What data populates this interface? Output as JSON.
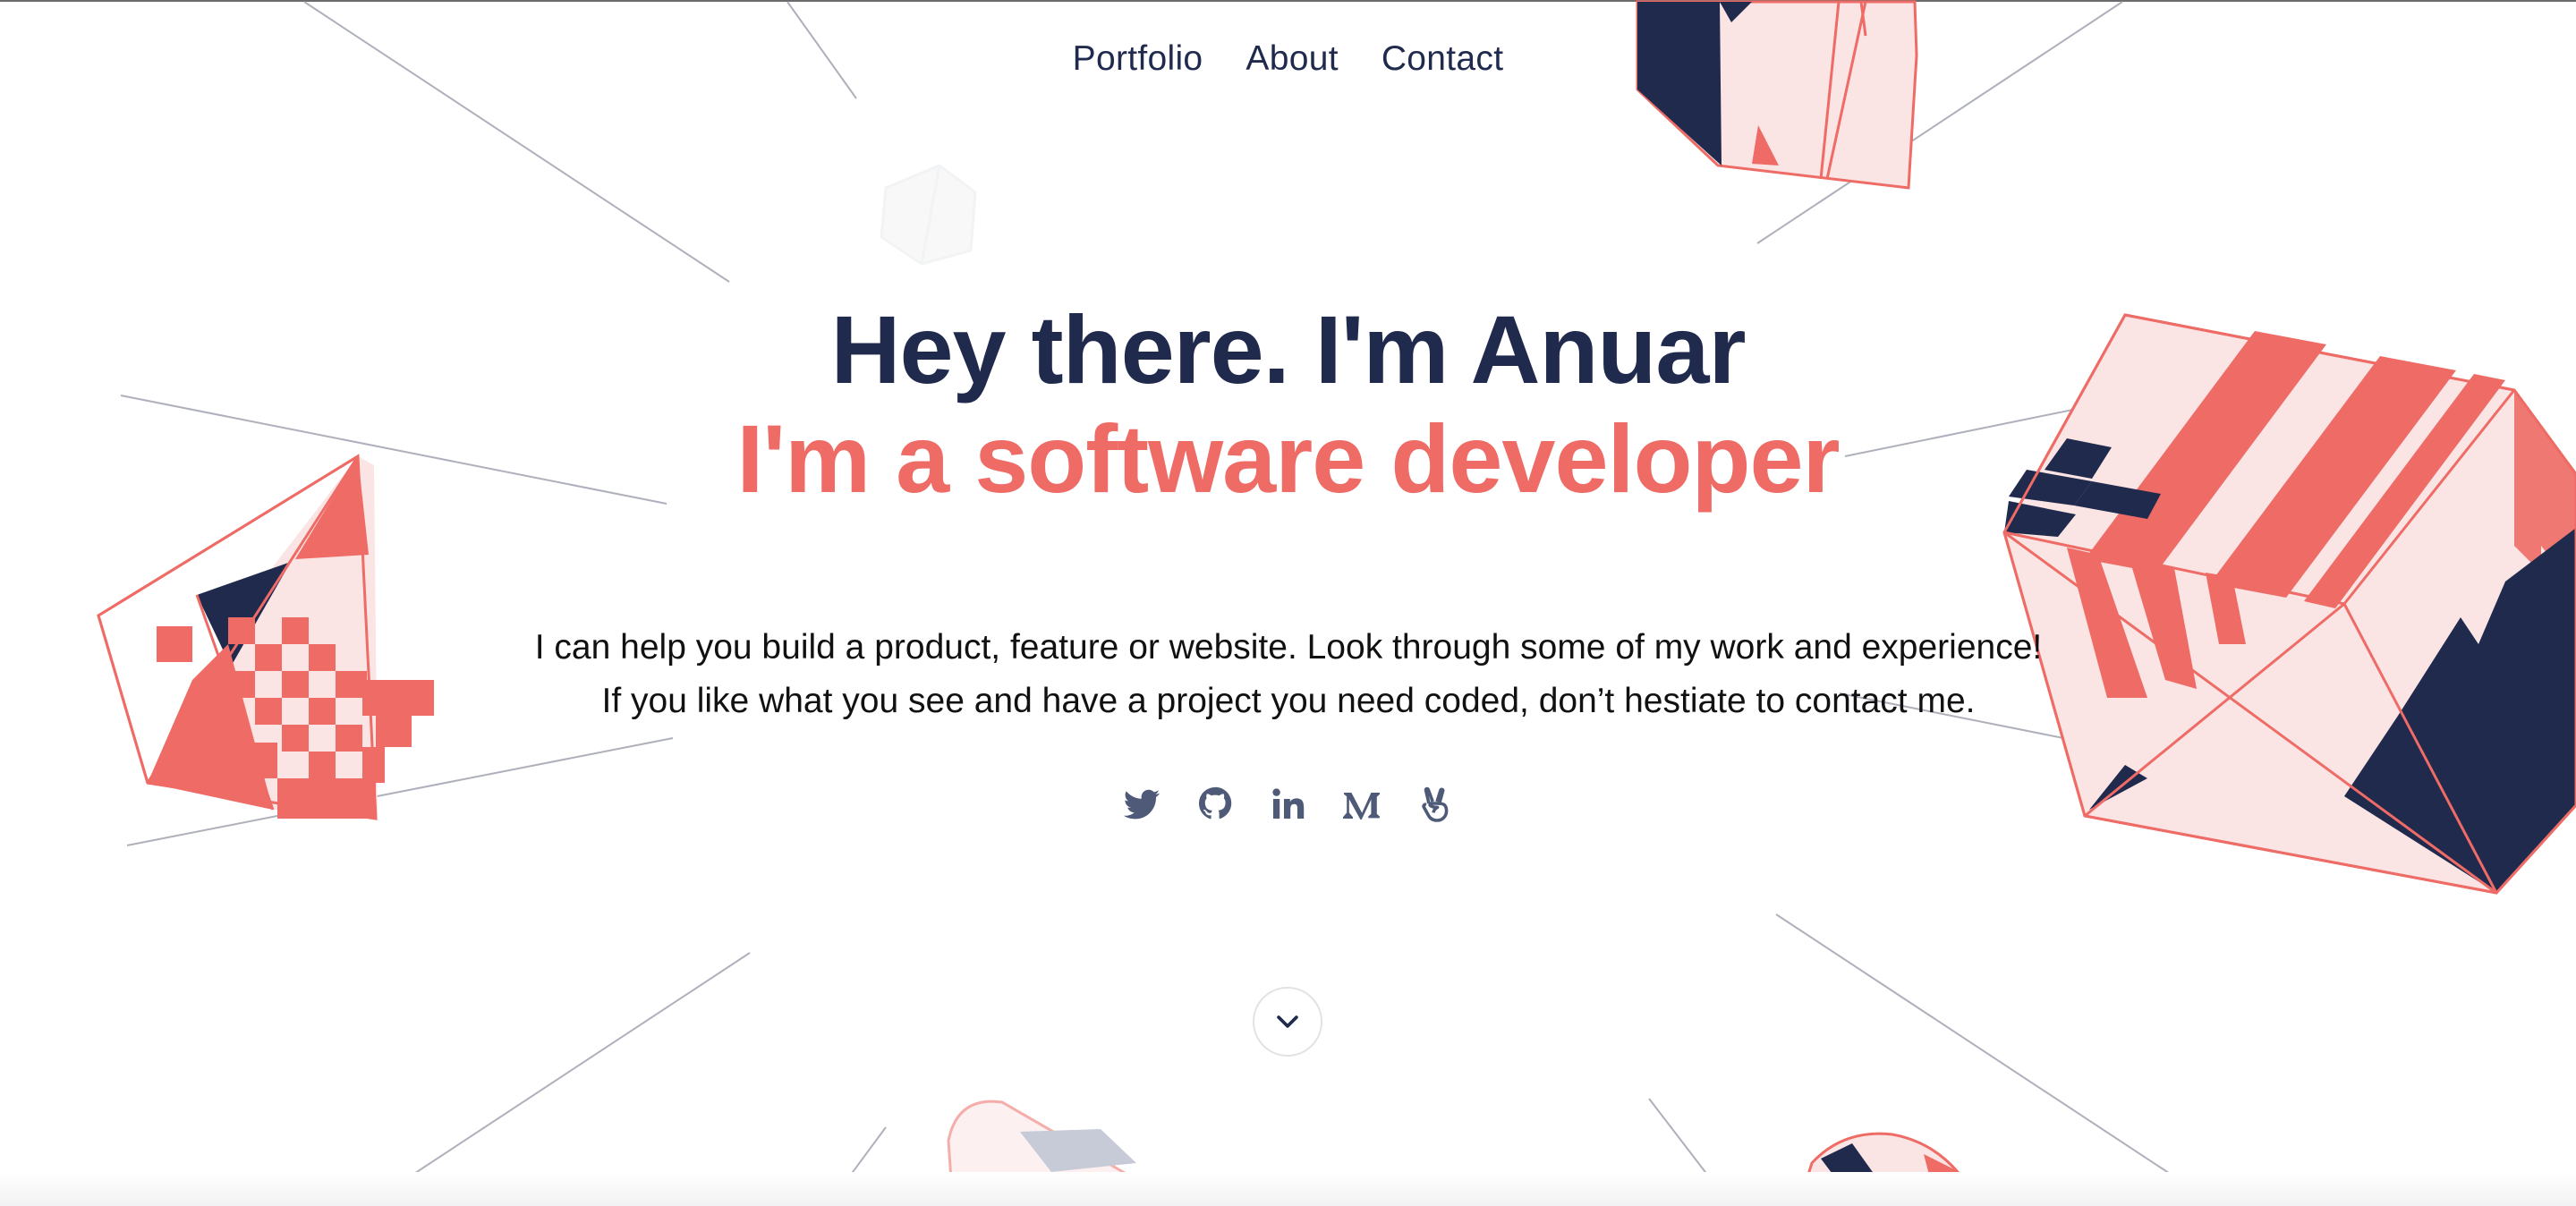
{
  "nav": {
    "items": [
      "Portfolio",
      "About",
      "Contact"
    ]
  },
  "hero": {
    "title": "Hey there. I'm Anuar",
    "subtitle": "I'm a software developer",
    "intro": "I can help you build a product, feature or website. Look through some of my work and experience! If you like what you see and have a project you need coded, don’t hestiate to contact me."
  },
  "social": {
    "icons": [
      "twitter-icon",
      "github-icon",
      "linkedin-icon",
      "medium-icon",
      "angellist-icon"
    ]
  },
  "scroll": {
    "icon": "chevron-down-icon"
  },
  "colors": {
    "navy": "#1f2a4d",
    "coral": "#ee6b66",
    "pink": "#fbe4e4",
    "icon_gray": "#4e5a78"
  }
}
